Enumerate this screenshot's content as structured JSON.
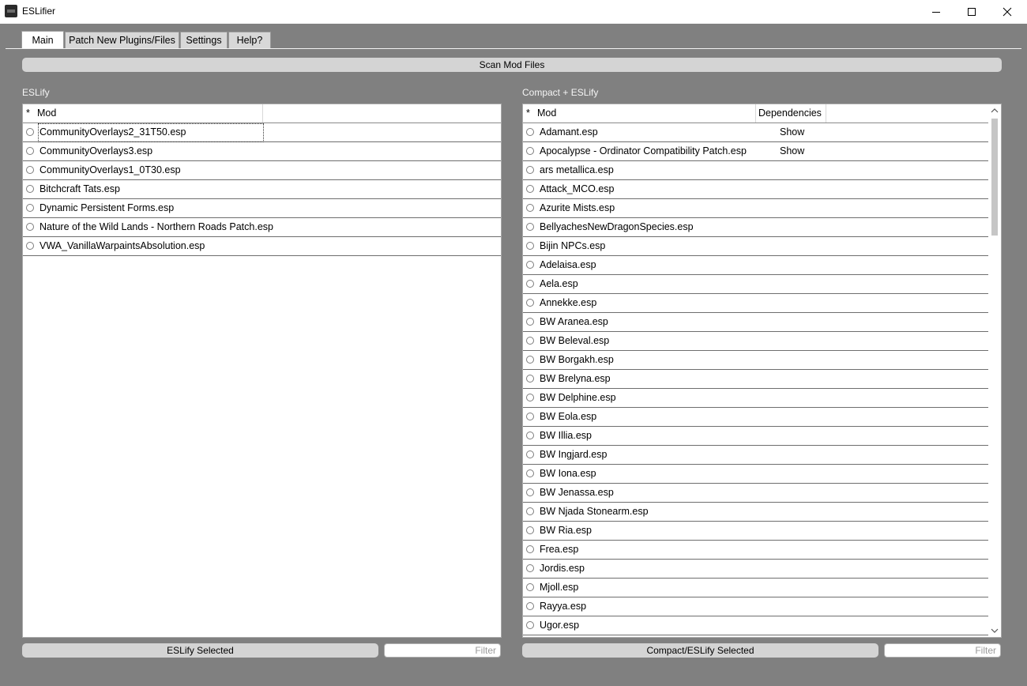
{
  "window": {
    "title": "ESLifier",
    "icon": "eslifier-app-icon",
    "controls": [
      "minimize-icon",
      "maximize-icon",
      "close-icon"
    ]
  },
  "tabs": [
    {
      "label": "Main",
      "active": true
    },
    {
      "label": "Patch New Plugins/Files",
      "active": false
    },
    {
      "label": "Settings",
      "active": false
    },
    {
      "label": "Help?",
      "active": false
    }
  ],
  "scan_button": "Scan Mod Files",
  "left": {
    "section_label": "ESLify",
    "header_star": "*",
    "header_mod": "Mod",
    "rows": [
      "CommunityOverlays2_31T50.esp",
      "CommunityOverlays3.esp",
      "CommunityOverlays1_0T30.esp",
      "Bitchcraft Tats.esp",
      "Dynamic Persistent Forms.esp",
      "Nature of the Wild Lands - Northern Roads Patch.esp",
      "VWA_VanillaWarpaintsAbsolution.esp"
    ],
    "action_button": "ESLify Selected",
    "filter_placeholder": "Filter"
  },
  "right": {
    "section_label": "Compact + ESLify",
    "header_star": "*",
    "header_mod": "Mod",
    "header_dependencies": "Dependencies",
    "rows": [
      {
        "mod": "Adamant.esp",
        "dep": "Show"
      },
      {
        "mod": "Apocalypse - Ordinator Compatibility Patch.esp",
        "dep": "Show"
      },
      {
        "mod": "ars metallica.esp",
        "dep": ""
      },
      {
        "mod": "Attack_MCO.esp",
        "dep": ""
      },
      {
        "mod": "Azurite Mists.esp",
        "dep": ""
      },
      {
        "mod": "BellyachesNewDragonSpecies.esp",
        "dep": ""
      },
      {
        "mod": "Bijin NPCs.esp",
        "dep": ""
      },
      {
        "mod": "Adelaisa.esp",
        "dep": ""
      },
      {
        "mod": "Aela.esp",
        "dep": ""
      },
      {
        "mod": "Annekke.esp",
        "dep": ""
      },
      {
        "mod": "BW Aranea.esp",
        "dep": ""
      },
      {
        "mod": "BW Beleval.esp",
        "dep": ""
      },
      {
        "mod": "BW Borgakh.esp",
        "dep": ""
      },
      {
        "mod": "BW Brelyna.esp",
        "dep": ""
      },
      {
        "mod": "BW Delphine.esp",
        "dep": ""
      },
      {
        "mod": "BW Eola.esp",
        "dep": ""
      },
      {
        "mod": "BW Illia.esp",
        "dep": ""
      },
      {
        "mod": "BW Ingjard.esp",
        "dep": ""
      },
      {
        "mod": "BW Iona.esp",
        "dep": ""
      },
      {
        "mod": "BW Jenassa.esp",
        "dep": ""
      },
      {
        "mod": "BW Njada Stonearm.esp",
        "dep": ""
      },
      {
        "mod": "BW Ria.esp",
        "dep": ""
      },
      {
        "mod": "Frea.esp",
        "dep": ""
      },
      {
        "mod": "Jordis.esp",
        "dep": ""
      },
      {
        "mod": "Mjoll.esp",
        "dep": ""
      },
      {
        "mod": "Rayya.esp",
        "dep": ""
      },
      {
        "mod": "Ugor.esp",
        "dep": ""
      }
    ],
    "action_button": "Compact/ESLify Selected",
    "filter_placeholder": "Filter"
  }
}
